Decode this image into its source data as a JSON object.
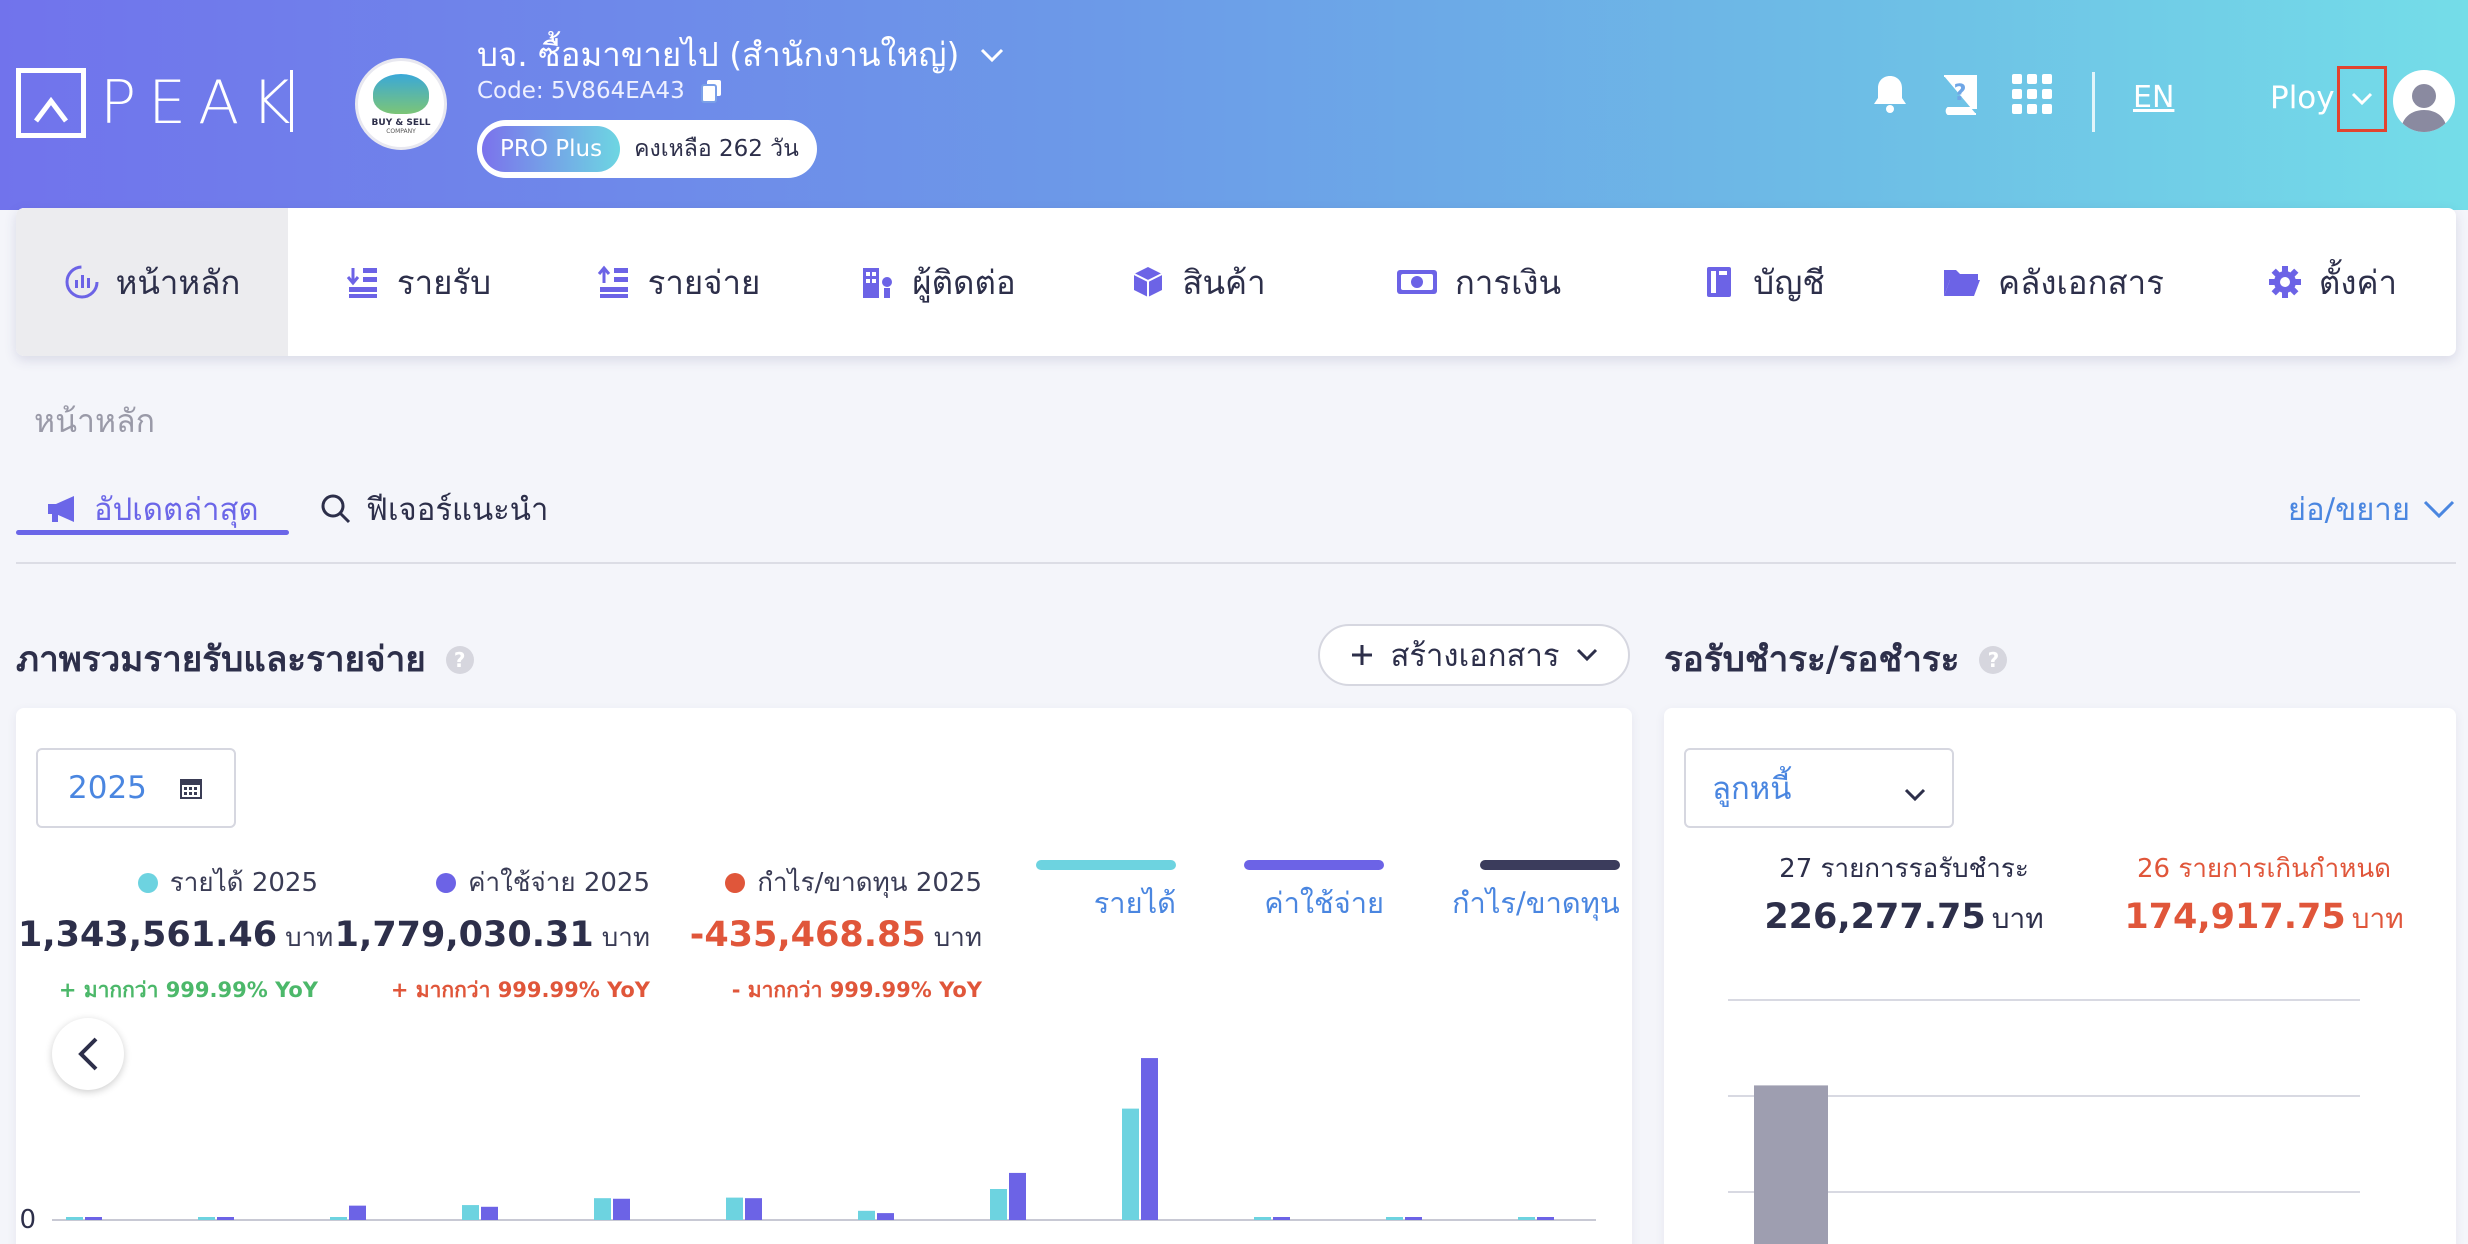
{
  "header": {
    "logo_text": "PEAK",
    "company_name": "บจ. ซื้อมาขายไป (สำนักงานใหญ่)",
    "company_code": "Code: 5V864EA43",
    "company_logo_text": "BUY & SELL",
    "company_logo_sub": "COMPANY",
    "plan_badge": "PRO Plus",
    "plan_remaining": "คงเหลือ 262 วัน",
    "language": "EN",
    "username": "Ploy"
  },
  "nav": {
    "items": [
      {
        "label": "หน้าหลัก",
        "icon": "dashboard-icon"
      },
      {
        "label": "รายรับ",
        "icon": "income-icon"
      },
      {
        "label": "รายจ่าย",
        "icon": "expense-icon"
      },
      {
        "label": "ผู้ติดต่อ",
        "icon": "contacts-icon"
      },
      {
        "label": "สินค้า",
        "icon": "box-icon"
      },
      {
        "label": "การเงิน",
        "icon": "money-icon"
      },
      {
        "label": "บัญชี",
        "icon": "ledger-icon"
      },
      {
        "label": "คลังเอกสาร",
        "icon": "folder-icon"
      },
      {
        "label": "ตั้งค่า",
        "icon": "gear-icon"
      }
    ]
  },
  "breadcrumb": "หน้าหลัก",
  "tabs": {
    "updates": "อัปเดตล่าสุด",
    "features": "ฟีเจอร์แนะนำ",
    "collapse": "ย่อ/ขยาย"
  },
  "overview": {
    "title": "ภาพรวมรายรับและรายจ่าย",
    "help": "?",
    "create_button": "สร้างเอกสาร",
    "year": "2025",
    "stats": {
      "income": {
        "label": "รายได้ 2025",
        "value": "1,343,561.46",
        "unit": "บาท",
        "yoy": "+ มากกว่า 999.99% YoY"
      },
      "expense": {
        "label": "ค่าใช้จ่าย 2025",
        "value": "1,779,030.31",
        "unit": "บาท",
        "yoy": "+ มากกว่า 999.99% YoY"
      },
      "profit": {
        "label": "กำไร/ขาดทุน 2025",
        "value": "-435,468.85",
        "unit": "บาท",
        "yoy": "- มากกว่า 999.99% YoY"
      }
    },
    "legend": {
      "income": "รายได้",
      "expense": "ค่าใช้จ่าย",
      "profit": "กำไร/ขาดทุน"
    },
    "colors": {
      "income": "#6dd3e0",
      "expense": "#6c63e6",
      "profit": "#3b3c5c",
      "positive": "#4cb86a",
      "negative": "#e0563a"
    }
  },
  "chart_data": {
    "type": "bar",
    "series": [
      {
        "name": "รายได้",
        "values": [
          1500,
          1800,
          0,
          13000,
          19000,
          19500,
          8000,
          27000,
          97000,
          500,
          400,
          600
        ]
      },
      {
        "name": "ค่าใช้จ่าย",
        "values": [
          1200,
          1700,
          12500,
          11500,
          18500,
          19000,
          6000,
          41000,
          141000,
          500,
          500,
          600
        ]
      }
    ],
    "y_tick_label": "0",
    "ylim": [
      0,
      155000
    ]
  },
  "receivables": {
    "title": "รอรับชำระ/รอชำระ",
    "help": "?",
    "select": "ลูกหนี้",
    "pending_label": "27 รายการรอรับชำระ",
    "pending_value": "226,277.75",
    "overdue_label": "26 รายการเกินกำหนด",
    "overdue_value": "174,917.75",
    "unit": "บาท",
    "bar_value_fraction": 0.65
  }
}
